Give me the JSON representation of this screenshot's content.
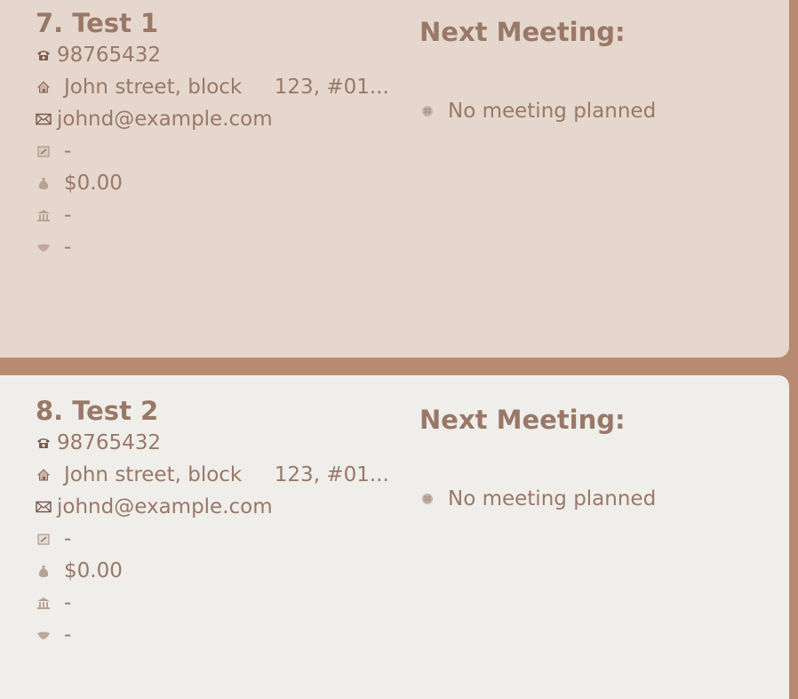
{
  "contacts": [
    {
      "index": "7.",
      "name": "Test 1",
      "phone": "98765432",
      "address": "John street, block     123, #01...",
      "email": "johnd@example.com",
      "note": "-",
      "amount": "$0.00",
      "bank": "-",
      "deal": "-",
      "next_meeting_title": "Next Meeting:",
      "next_meeting_value": "No meeting planned",
      "background": "#e5d7cd"
    },
    {
      "index": "8.",
      "name": "Test 2",
      "phone": "98765432",
      "address": "John street, block     123, #01...",
      "email": "johnd@example.com",
      "note": "-",
      "amount": "$0.00",
      "bank": "-",
      "deal": "-",
      "next_meeting_title": "Next Meeting:",
      "next_meeting_value": "No meeting planned",
      "background": "#f0eeeb"
    }
  ],
  "icons": {
    "phone": "phone-icon",
    "address": "house-icon",
    "email": "envelope-icon",
    "note": "memo-icon",
    "amount": "money-bag-icon",
    "bank": "bank-icon",
    "deal": "handshake-icon",
    "meeting": "calendar-icon"
  },
  "colors": {
    "frame": "#b88a72",
    "text": "#9a7867"
  }
}
